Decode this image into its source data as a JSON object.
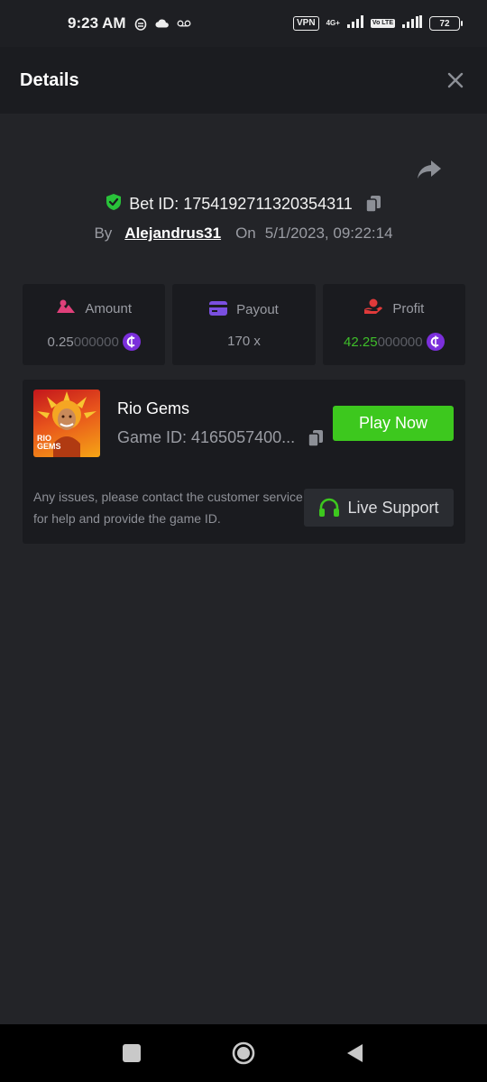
{
  "status_bar": {
    "time": "9:23 AM",
    "vpn": "VPN",
    "network": "4G+",
    "volte": "Vo LTE",
    "battery": "72"
  },
  "header": {
    "title": "Details"
  },
  "bet": {
    "id_label": "Bet ID: 1754192711320354311",
    "by_label": "By",
    "user": "Alejandrus31",
    "on_label": "On",
    "datetime": "5/1/2023, 09:22:14"
  },
  "stats": {
    "amount": {
      "label": "Amount",
      "value_main": "0.25",
      "value_dim": "000000"
    },
    "payout": {
      "label": "Payout",
      "value": "170 x"
    },
    "profit": {
      "label": "Profit",
      "value_main": "42.25",
      "value_dim": "000000"
    }
  },
  "game": {
    "name": "Rio Gems",
    "id_label": "Game ID: 4165057400...",
    "thumb_text_1": "RIO",
    "thumb_text_2": "GEMS",
    "play_label": "Play Now",
    "help_text": "Any issues, please contact the customer service for help and provide the game ID.",
    "support_label": "Live Support"
  },
  "colors": {
    "background": "#232428",
    "header": "#1b1c20",
    "card": "#1a1b1f",
    "accent_green": "#3dc81e",
    "profit_green": "#3fbf2a",
    "coin_purple": "#7b2fdb",
    "amount_pink": "#e0407a",
    "payout_purple": "#7a4fe0",
    "profit_red": "#e03a3a"
  },
  "icons": {
    "share": "share-arrow-icon",
    "shield": "shield-check-icon",
    "copy": "copy-icon",
    "close": "close-icon",
    "headset": "headset-icon"
  }
}
